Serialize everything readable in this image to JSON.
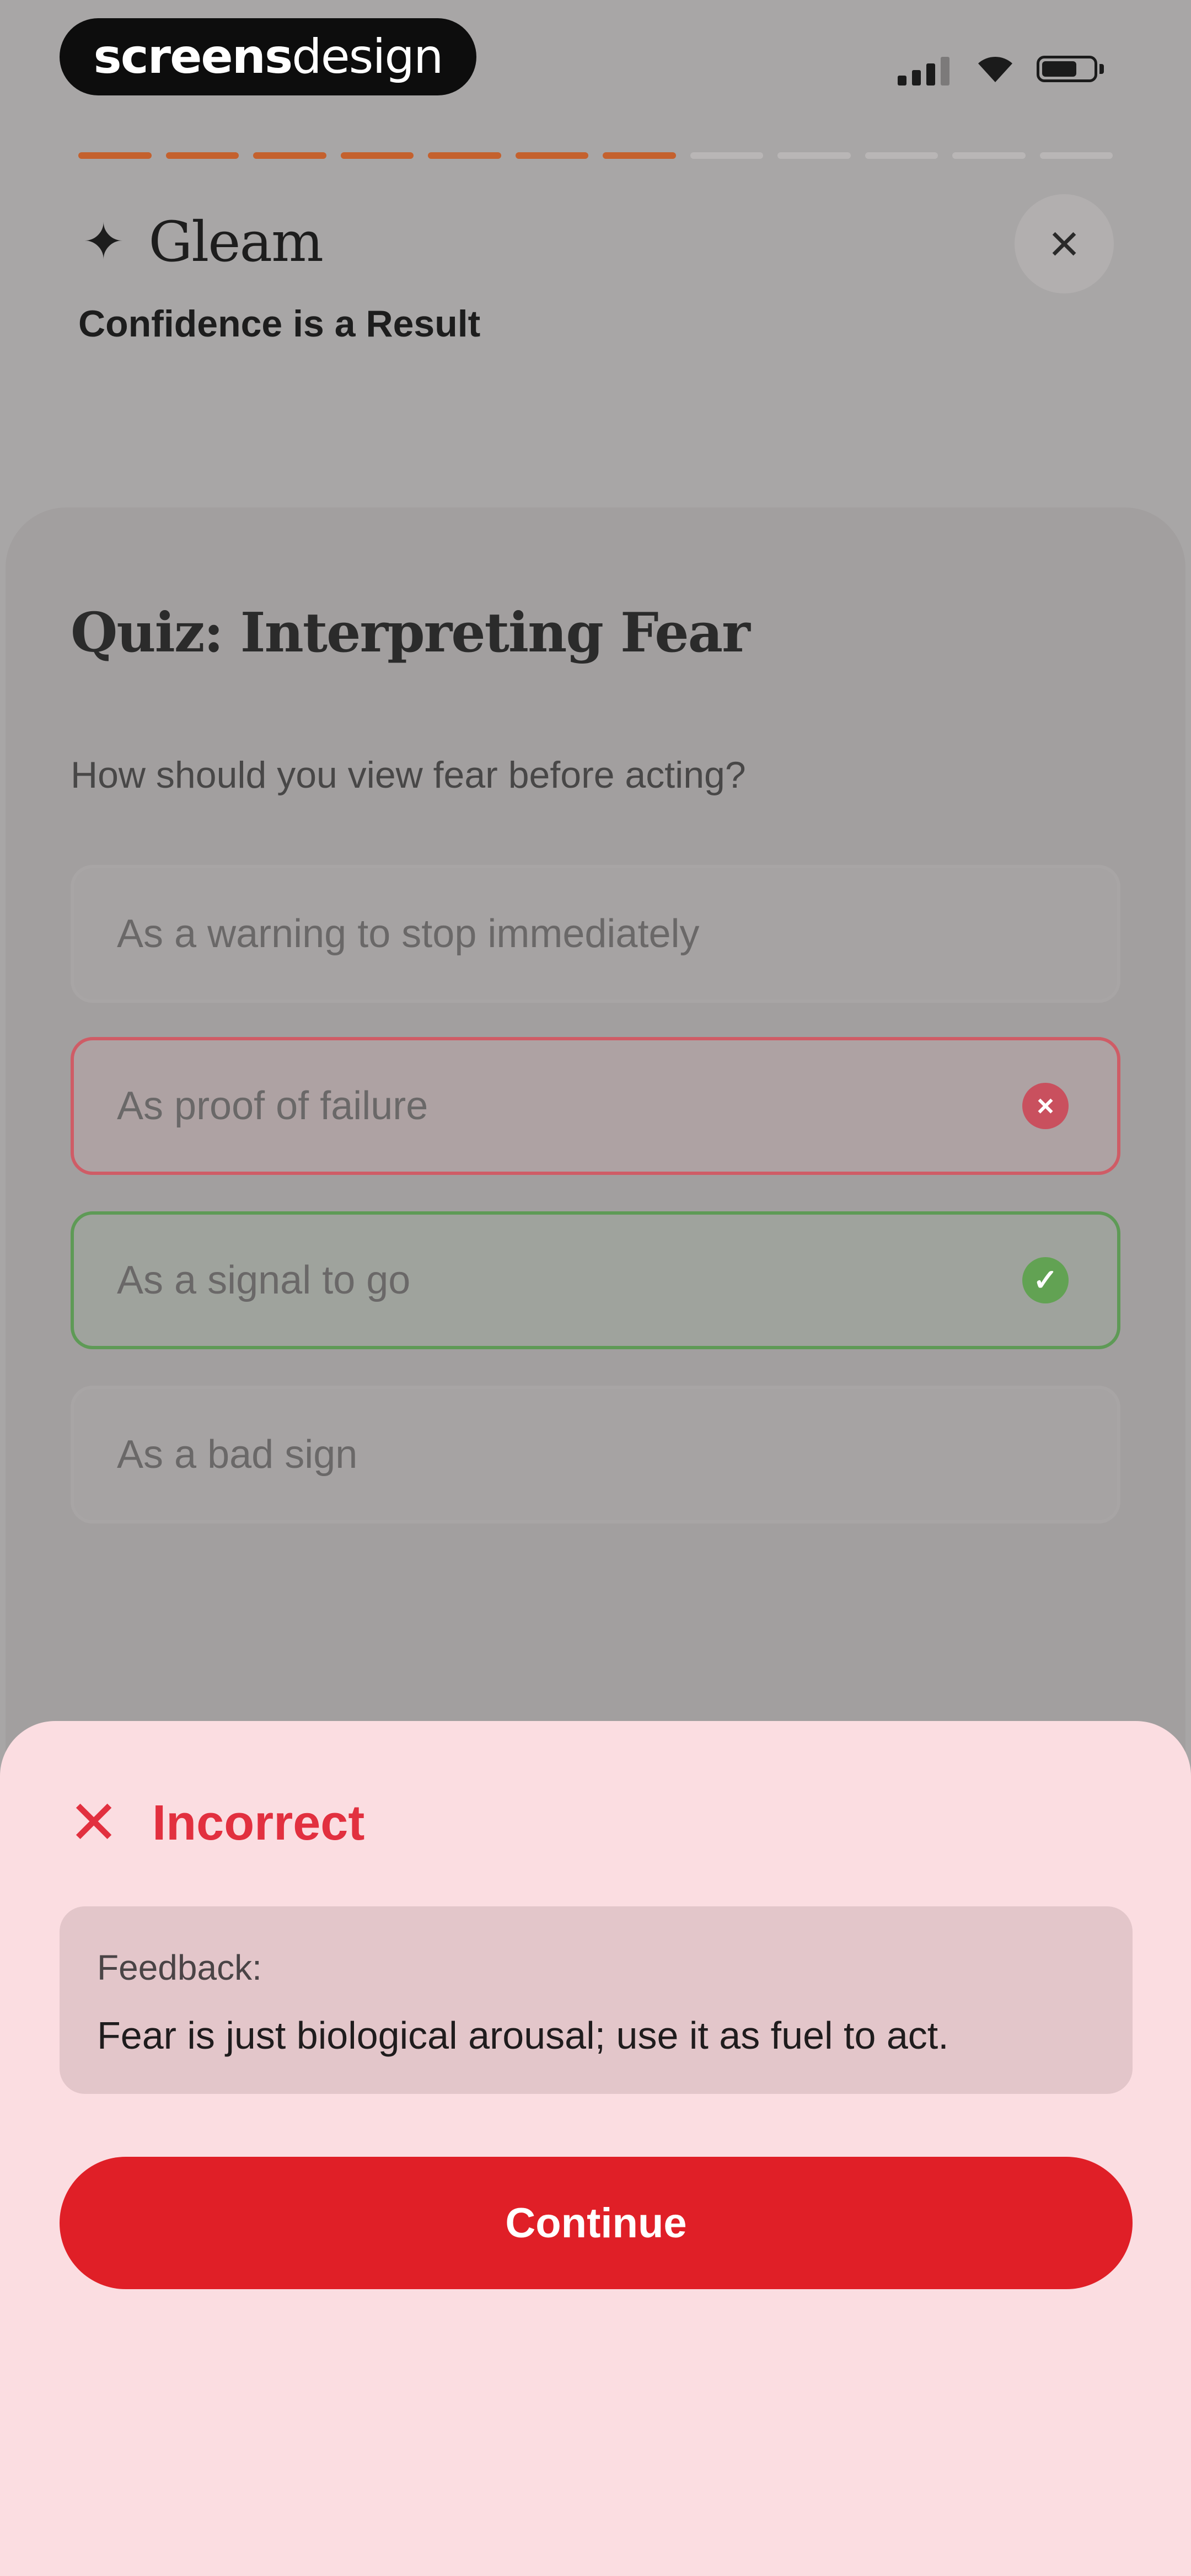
{
  "watermark": {
    "bold_part": "screens",
    "light_part": "design"
  },
  "status_bar": {
    "signal_icon": "cellular-signal-icon",
    "wifi_icon": "wifi-icon",
    "battery_icon": "battery-icon",
    "battery_level": 0.62
  },
  "progress": {
    "total_steps": 12,
    "completed_steps": 7,
    "accent": "#c4612e"
  },
  "header": {
    "spark_icon": "sparkle-icon",
    "brand": "Gleam",
    "close_icon": "close-icon",
    "lesson_title": "Confidence is a Result"
  },
  "quiz": {
    "title": "Quiz: Interpreting Fear",
    "question": "How should you view fear before acting?",
    "options": [
      {
        "label": "As a warning to stop immediately",
        "state": "default"
      },
      {
        "label": "As proof of failure",
        "state": "incorrect"
      },
      {
        "label": "As a signal to go",
        "state": "correct"
      },
      {
        "label": "As a bad sign",
        "state": "default"
      }
    ]
  },
  "feedback": {
    "status_icon": "x-icon",
    "status": "Incorrect",
    "label": "Feedback:",
    "text": "Fear is just biological arousal; use it as fuel to act.",
    "continue_label": "Continue",
    "error_color": "#e01f27"
  }
}
